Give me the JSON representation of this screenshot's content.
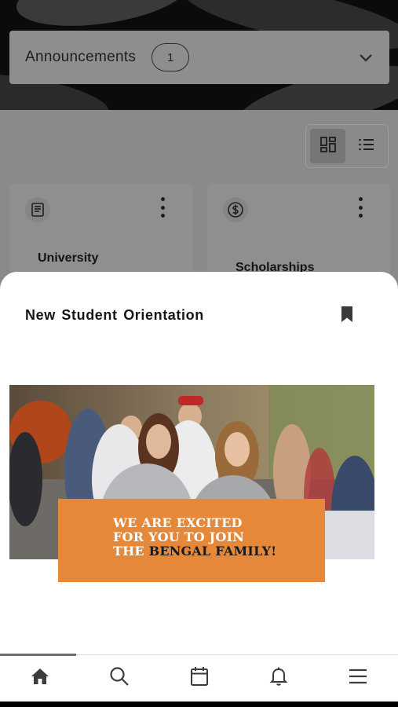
{
  "announcements": {
    "label": "Announcements",
    "count": "1",
    "chevron_icon": "chevron-down-icon"
  },
  "view_toggle": {
    "options": [
      "grid-view-icon",
      "list-view-icon"
    ],
    "selected": "grid-view-icon"
  },
  "cards": [
    {
      "title": "University",
      "icon": "book-icon"
    },
    {
      "title": "Scholarships",
      "icon": "dollar-coin-icon"
    }
  ],
  "sheet": {
    "title": "New Student Orientation",
    "bookmark_icon": "bookmark-icon",
    "promo": {
      "line1": "WE ARE EXCITED",
      "line2": "FOR YOU TO JOIN",
      "line3_prefix": "THE",
      "line3_highlight": "BENGAL FAMILY!"
    }
  },
  "tabbar": {
    "items": [
      "home-icon",
      "search-icon",
      "calendar-icon",
      "bell-icon",
      "menu-icon"
    ],
    "active": "home-icon"
  },
  "colors": {
    "promo_orange": "#e6883a",
    "overlay_gray": "#8a8a8a",
    "sheet": "#ffffff"
  }
}
